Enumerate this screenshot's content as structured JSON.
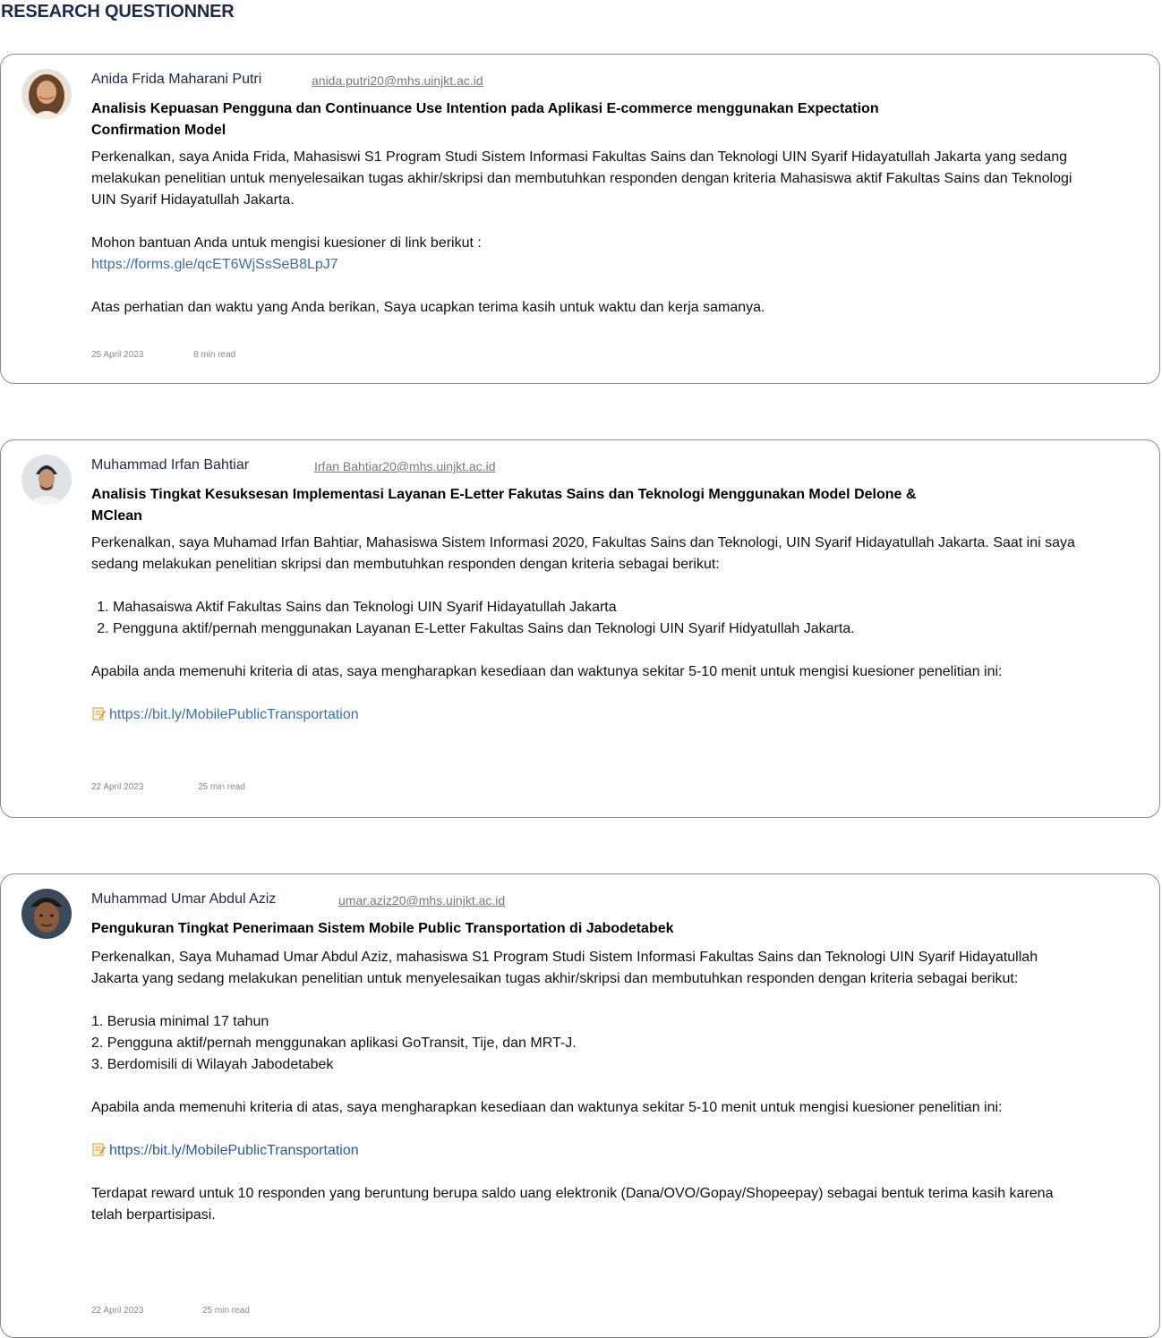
{
  "page": {
    "heading": "RESEARCH QUESTIONNER"
  },
  "posts": [
    {
      "author": "Anida Frida Maharani Putri",
      "email": "anida.putri20@mhs.uinjkt.ac.id",
      "title": "Analisis Kepuasan Pengguna dan Continuance Use Intention pada Aplikasi  E-commerce menggunakan Expectation Confirmation Model",
      "intro": "Perkenalkan, saya Anida Frida, Mahasiswi S1 Program Studi Sistem Informasi Fakultas Sains dan Teknologi UIN Syarif Hidayatullah Jakarta yang sedang melakukan penelitian untuk menyelesaikan tugas akhir/skripsi dan membutuhkan responden dengan kriteria Mahasiswa aktif Fakultas Sains dan Teknologi UIN Syarif Hidayatullah Jakarta.",
      "request": "Mohon bantuan Anda untuk mengisi kuesioner di link berikut :",
      "link": "https://forms.gle/qcET6WjSsSeB8LpJ7",
      "closing": "Atas perhatian dan waktu yang Anda berikan, Saya ucapkan terima kasih untuk waktu dan kerja samanya.",
      "date": "25 April 2023",
      "read_time": "8 min read"
    },
    {
      "author": "Muhammad Irfan Bahtiar",
      "email": "Irfan Bahtiar20@mhs.uinjkt.ac.id",
      "title": "Analisis Tingkat Kesuksesan Implementasi Layanan E-Letter Fakutas Sains dan Teknologi Menggunakan Model Delone & MClean",
      "intro": "Perkenalkan, saya Muhamad Irfan Bahtiar, Mahasiswa Sistem Informasi 2020, Fakultas Sains dan Teknologi, UIN Syarif Hidayatullah Jakarta. Saat ini saya sedang melakukan penelitian skripsi dan membutuhkan responden dengan kriteria sebagai berikut:",
      "criteria": [
        "Mahasaiswa Aktif Fakultas Sains dan Teknologi UIN Syarif Hidayatullah Jakarta",
        "Pengguna aktif/pernah menggunakan Layanan E-Letter Fakultas Sains dan Teknologi UIN Syarif Hidyatullah Jakarta."
      ],
      "request": "Apabila anda memenuhi kriteria di atas, saya mengharapkan kesediaan dan waktunya sekitar 5-10 menit untuk mengisi kuesioner penelitian ini:",
      "link": "https://bit.ly/MobilePublicTransportation",
      "date": "22 April 2023",
      "read_time": "25 min read"
    },
    {
      "author": "Muhammad Umar Abdul Aziz",
      "email": "umar.aziz20@mhs.uinjkt.ac.id",
      "title": "Pengukuran Tingkat Penerimaan Sistem Mobile Public Transportation di Jabodetabek",
      "intro": "Perkenalkan, Saya Muhamad Umar Abdul Aziz, mahasiswa S1 Program Studi Sistem Informasi Fakultas Sains dan Teknologi UIN Syarif Hidayatullah Jakarta yang sedang melakukan penelitian untuk menyelesaikan tugas akhir/skripsi dan membutuhkan responden dengan kriteria sebagai berikut:",
      "criteria": [
        "1. Berusia minimal 17 tahun",
        "2. Pengguna aktif/pernah menggunakan aplikasi GoTransit, Tije, dan MRT-J.",
        "3. Berdomisili di Wilayah Jabodetabek"
      ],
      "request": "Apabila anda memenuhi kriteria di atas, saya mengharapkan kesediaan dan waktunya sekitar 5-10 menit untuk mengisi kuesioner penelitian ini:",
      "link": "https://bit.ly/MobilePublicTransportation",
      "reward": "Terdapat reward untuk 10 responden yang beruntung berupa saldo uang elektronik (Dana/OVO/Gopay/Shopeepay) sebagai bentuk terima kasih karena telah berpartisipasi.",
      "date": "22 April 2023",
      "read_time": "25 min read"
    }
  ]
}
